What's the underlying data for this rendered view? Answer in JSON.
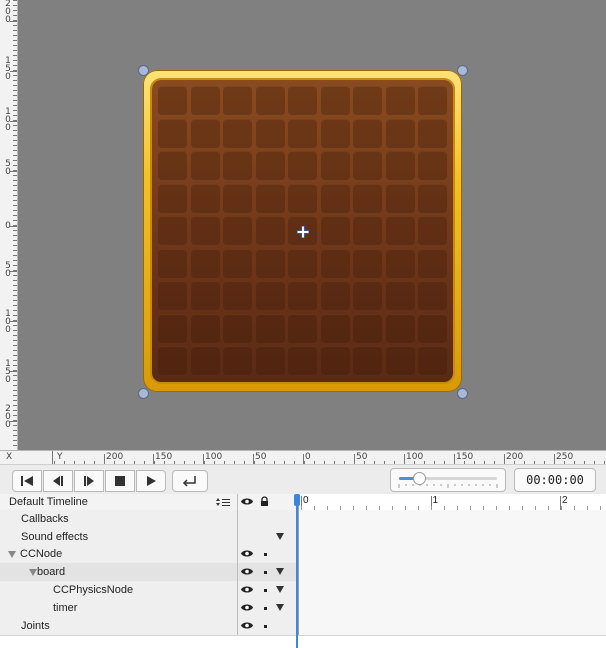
{
  "canvas": {
    "vruler_labels": [
      "2\n0\n0",
      "1\n5\n0",
      "1\n0\n0",
      "5\n0",
      "0",
      "5\n0",
      "1\n0\n0",
      "1\n5\n0",
      "2\n0\n0"
    ],
    "hruler": {
      "x_label": "X",
      "y_label": "Y",
      "labels": [
        "200",
        "150",
        "100",
        "50",
        "0",
        "50",
        "100",
        "150",
        "200",
        "250"
      ]
    },
    "board": {
      "rows": 9,
      "cols": 9
    }
  },
  "toolbar": {
    "buttons": [
      {
        "name": "go-to-start-button",
        "icon": "skip-back-icon"
      },
      {
        "name": "step-back-button",
        "icon": "step-back-icon"
      },
      {
        "name": "step-forward-button",
        "icon": "step-forward-icon"
      },
      {
        "name": "stop-button",
        "icon": "stop-icon"
      },
      {
        "name": "play-button",
        "icon": "play-icon"
      },
      {
        "name": "loop-button",
        "icon": "loop-icon"
      }
    ],
    "zoom_level": 0.2,
    "time": "00:00:00"
  },
  "timeline": {
    "selector_label": "Default Timeline",
    "ruler_labels": [
      "0",
      "1",
      "2"
    ],
    "rows": [
      {
        "label": "Callbacks",
        "indent": 1,
        "eye": false,
        "lock": false,
        "tri": false,
        "expand": false
      },
      {
        "label": "Sound effects",
        "indent": 1,
        "eye": false,
        "lock": false,
        "tri": true,
        "expand": false
      },
      {
        "label": "CCNode",
        "indent": 0,
        "eye": true,
        "lock": true,
        "tri": false,
        "expand": true
      },
      {
        "label": "board",
        "indent": 1,
        "eye": true,
        "lock": true,
        "tri": true,
        "expand": true
      },
      {
        "label": "CCPhysicsNode",
        "indent": 2,
        "eye": true,
        "lock": true,
        "tri": true,
        "expand": false
      },
      {
        "label": "timer",
        "indent": 2,
        "eye": true,
        "lock": true,
        "tri": true,
        "expand": false
      },
      {
        "label": "Joints",
        "indent": 1,
        "eye": true,
        "lock": true,
        "tri": false,
        "expand": false
      }
    ]
  },
  "colors": {
    "canvas": "#808080",
    "playhead": "#3a86e0",
    "board_frame": "#f4c020"
  }
}
